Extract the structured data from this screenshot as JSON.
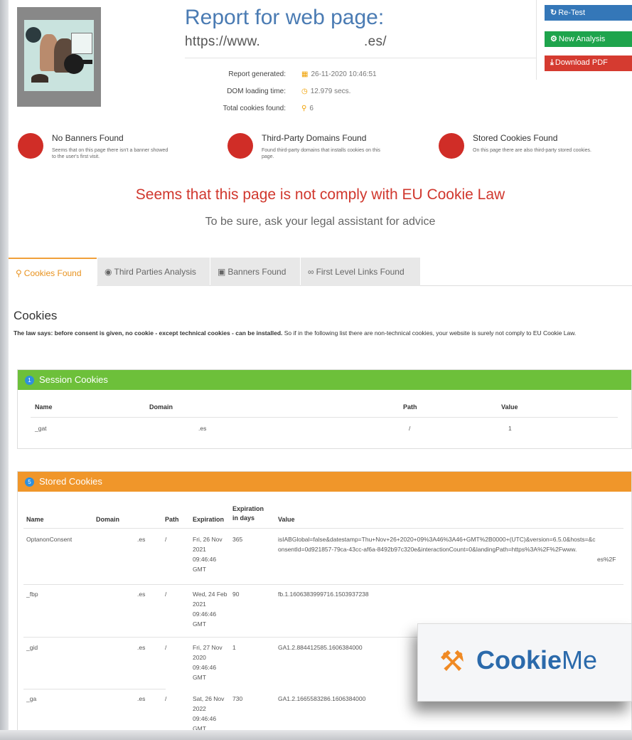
{
  "header": {
    "title": "Report for web page:",
    "url_prefix": "https://www.",
    "url_suffix": ".es/",
    "report_generated_label": "Report generated:",
    "report_generated_value": "26-11-2020 10:46:51",
    "dom_loading_label": "DOM loading time:",
    "dom_loading_value": "12.979 secs.",
    "total_cookies_label": "Total cookies found:",
    "total_cookies_value": "6"
  },
  "buttons": {
    "retest": "Re-Test",
    "new_analysis": "New Analysis",
    "download_pdf": "Download PDF"
  },
  "findings": [
    {
      "title": "No Banners Found",
      "desc": "Seems that on this page there isn't a banner showed to the user's first visit."
    },
    {
      "title": "Third-Party Domains Found",
      "desc": "Found third-party domains that installs cookies on this page."
    },
    {
      "title": "Stored Cookies Found",
      "desc": "On this page there are also third-party stored cookies."
    }
  ],
  "verdict": {
    "headline": "Seems that this page is not comply with EU Cookie Law",
    "subline": "To be sure, ask your legal assistant for advice"
  },
  "tabs": [
    {
      "label": "Cookies Found",
      "icon": "search-icon",
      "active": true
    },
    {
      "label": "Third Parties Analysis",
      "icon": "globe-icon",
      "active": false
    },
    {
      "label": "Banners Found",
      "icon": "banner-icon",
      "active": false
    },
    {
      "label": "First Level Links Found",
      "icon": "link-icon",
      "active": false
    }
  ],
  "cookies_section": {
    "title": "Cookies",
    "law_bold": "The law says: before consent is given, no cookie - except technical cookies - can be installed.",
    "law_rest": " So if in the following list there are non-technical cookies, your website is surely not comply to EU Cookie Law."
  },
  "session_cookies": {
    "badge": "1",
    "title": "Session Cookies",
    "headers": [
      "Name",
      "Domain",
      "Path",
      "Value"
    ],
    "rows": [
      {
        "name": "_gat",
        "domain": ".es",
        "path": "/",
        "value": "1"
      }
    ]
  },
  "stored_cookies": {
    "badge": "5",
    "title": "Stored Cookies",
    "headers": [
      "Name",
      "Domain",
      "Path",
      "Expiration",
      "Expiration in days",
      "Value"
    ],
    "rows": [
      {
        "name": "OptanonConsent",
        "domain": ".es",
        "path": "/",
        "expiration": "Fri, 26 Nov 2021 09:46:46 GMT",
        "days": "365",
        "value": "isIABGlobal=false&datestamp=Thu+Nov+26+2020+09%3A46%3A46+GMT%2B0000+(UTC)&version=6.5.0&hosts=&consentId=0d921857-79ca-43cc-af6a-8492b97c320e&interactionCount=0&landingPath=https%3A%2F%2Fwww.",
        "value_tail": "es%2F"
      },
      {
        "name": "_fbp",
        "domain": ".es",
        "path": "/",
        "expiration": "Wed, 24 Feb 2021 09:46:46 GMT",
        "days": "90",
        "value": "fb.1.1606383999716.1503937238"
      },
      {
        "name": "_gid",
        "domain": ".es",
        "path": "/",
        "expiration": "Fri, 27 Nov 2020 09:46:46 GMT",
        "days": "1",
        "value": "GA1.2.884412585.1606384000"
      },
      {
        "name": "_ga",
        "domain": ".es",
        "path": "/",
        "expiration": "Sat, 26 Nov 2022 09:46:46 GMT",
        "days": "730",
        "value": "GA1.2.1665583286.1606384000"
      }
    ]
  },
  "overlay": {
    "brand_bold": "Cookie",
    "brand_rest": "Me"
  },
  "colors": {
    "title_blue": "#4a7bb3",
    "alert_red": "#d0372d",
    "session_green": "#6dc03a",
    "stored_orange": "#f0962a",
    "btn_blue": "#3477b8",
    "btn_green": "#1ea44c",
    "btn_red": "#d53b30"
  }
}
